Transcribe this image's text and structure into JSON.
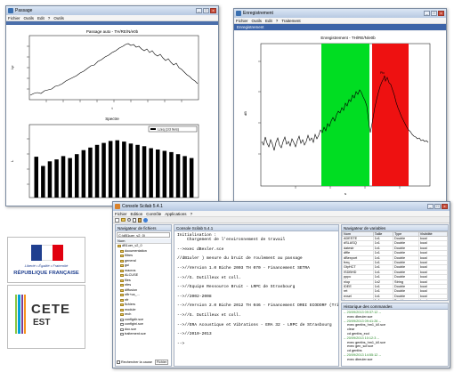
{
  "passage_window": {
    "title": "Passage",
    "menu": [
      "Fichier",
      "Outils",
      "Edit",
      "?",
      "Outils"
    ],
    "chart1": {
      "title": "Passage auto - TH/RE/N/e0b"
    },
    "chart2": {
      "title": "Spectre",
      "legend": "Lzeq (1/3 tiers)"
    }
  },
  "enregistrement_window": {
    "title": "Enregistrement",
    "menu": [
      "Fichier",
      "Outils",
      "Edit",
      "?",
      "Traitement"
    ],
    "subbar": "Enregistrement",
    "chart_title": "Enregistrement - TH/RE/N/e0b",
    "peak_label": "Pic"
  },
  "console_window": {
    "title": "Console Scilab 5.4.1",
    "menu": [
      "Fichier",
      "Edition",
      "Contrôle",
      "Applications",
      "?"
    ],
    "file_browser": {
      "header": "Navigateur de fichiers",
      "path": "C:\\dB1uer_v2_0\\",
      "column": "Nom",
      "items": [
        "dB1uer_v2_0",
        "documentation",
        "filtres",
        "general",
        "gui",
        "macros",
        "ALCUSE",
        "files",
        "nfes",
        "diffusion",
        "nfb+ca_...",
        "nfr",
        "fichiers",
        "module",
        "rech",
        "configdir.sce",
        "configini.sce",
        "doc.sce",
        "traitement.sce"
      ],
      "checkbox": "Rechercher la cause",
      "dropdown": "Fichier"
    },
    "console": {
      "header": "Console Scilab 5.4.1",
      "lines": [
        "Initialisation :",
        "    Chargement de l'environnement de travail",
        "",
        "-->exec dBexler.sce",
        "",
        "//dB1uler ) mesure du bruit de roulement au passage",
        "",
        "-->//Version 1.0 Biche 2003 TH 070 - Financement SETRA",
        "",
        "-->//G. Dutilleux et coll.",
        "",
        "-->//Equipe Ressource Bruit - LRPC de Strasbourg",
        "",
        "-->//2002-2008",
        "",
        "-->//Version 2.0 Biche 2012 TH 046 - Financement DREI ECODORF (Tritia",
        "",
        "-->//G. Dutilleux et coll.",
        "",
        "-->//ERA Acoustique et Vibrations - ERA 32 - LRPC de Strasbourg",
        "",
        "-->//2010-2013",
        "",
        "-->"
      ]
    },
    "variables": {
      "header": "Navigateur de variables",
      "columns": [
        "Nom",
        "Taille",
        "Type",
        "Visibilité"
      ],
      "rows": [
        [
          "ADESTE",
          "1x1",
          "Double",
          "local"
        ],
        [
          "dSLASQ",
          "1x1",
          "Double",
          "local"
        ],
        [
          "datestr",
          "1x1",
          "Double",
          "local"
        ],
        [
          "dffle",
          "1x1",
          "Double",
          "local"
        ],
        [
          "dBexport",
          "1x1",
          "Double",
          "local"
        ],
        [
          "freq",
          "1x1",
          "Double",
          "local"
        ],
        [
          "GtyHCT",
          "1x1",
          "Double",
          "local"
        ],
        [
          "ISDBHD",
          "1x1",
          "Double",
          "local"
        ],
        [
          "pppc",
          "1x1",
          "Double",
          "local"
        ],
        [
          "nlop",
          "1x2",
          "String",
          "local"
        ],
        [
          "IDEE",
          "1x1",
          "Double",
          "local"
        ],
        [
          "ret",
          "1x1",
          "Double",
          "local"
        ],
        [
          "exsel",
          "1x1",
          "Double",
          "local"
        ],
        [
          "lo",
          "1x1",
          "Double",
          "local"
        ],
        [
          "ul",
          "1x1",
          "Double",
          "local"
        ]
      ]
    },
    "history": {
      "header": "Historique des commandes",
      "lines": [
        "-- 20/09/2013 09:37:12 --",
        "exec dbeuler.sce",
        "-- 20/09/2013 09:41:26 --",
        "exec gentbs_hm1_k0.sce",
        "clear",
        "cd gentbs_ecd",
        "-- 20/09/2013 10:12:3 --",
        "exec gentbs_hm1_k0.sce",
        "exec gen_scf.sce",
        "cd gentbs",
        "-- 20/09/2013 14:55:12 --",
        "exec dbeuler.sce"
      ]
    }
  },
  "logos": {
    "marianne_motto": "Liberté • Égalité • Fraternité",
    "marianne_name": "RÉPUBLIQUE FRANÇAISE",
    "cete_line1": "CETE",
    "cete_line2": "EST"
  },
  "colors": {
    "green_zone": "#00dd22",
    "red_zone": "#ee1111",
    "title_bar": "#c8d6ea"
  }
}
